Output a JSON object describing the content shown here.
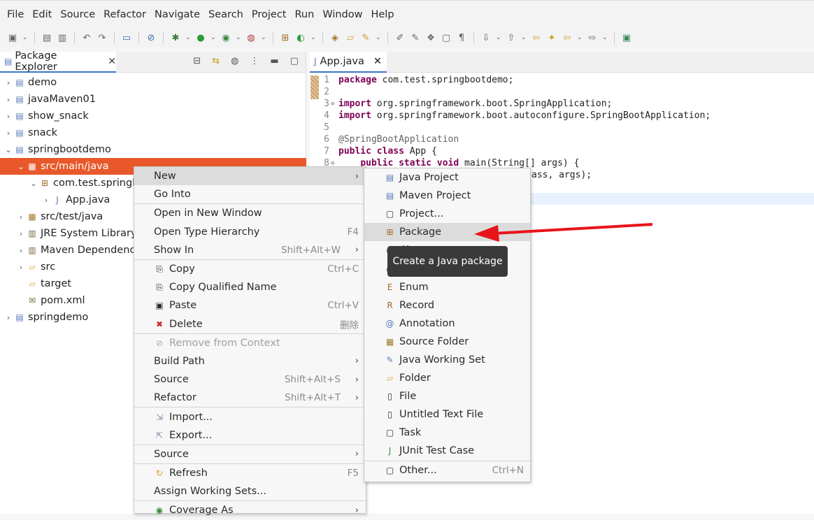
{
  "menubar": [
    "File",
    "Edit",
    "Source",
    "Refactor",
    "Navigate",
    "Search",
    "Project",
    "Run",
    "Window",
    "Help"
  ],
  "package_explorer": {
    "title": "Package Explorer",
    "tree": [
      {
        "label": "demo",
        "icon": "project-icon",
        "twisty": "›"
      },
      {
        "label": "javaMaven01",
        "icon": "project-icon",
        "twisty": "›"
      },
      {
        "label": "show_snack",
        "icon": "project-icon",
        "twisty": "›"
      },
      {
        "label": "snack",
        "icon": "project-icon",
        "twisty": "›"
      },
      {
        "label": "springbootdemo",
        "icon": "maven-project-icon",
        "twisty": "⌄"
      },
      {
        "label": "src/main/java",
        "icon": "source-folder-icon",
        "twisty": "⌄"
      },
      {
        "label": "com.test.springbootdemo",
        "icon": "package-icon",
        "twisty": "⌄"
      },
      {
        "label": "App.java",
        "icon": "java-file-icon",
        "twisty": "›"
      },
      {
        "label": "src/test/java",
        "icon": "source-folder-icon",
        "twisty": "›"
      },
      {
        "label": "JRE System Library [",
        "icon": "library-icon",
        "twisty": "›"
      },
      {
        "label": "Maven Dependencies",
        "icon": "library-icon",
        "twisty": "›"
      },
      {
        "label": "src",
        "icon": "folder-icon",
        "twisty": "›"
      },
      {
        "label": "target",
        "icon": "folder-icon",
        "twisty": ""
      },
      {
        "label": "pom.xml",
        "icon": "xml-file-icon",
        "twisty": ""
      },
      {
        "label": "springdemo",
        "icon": "project-icon",
        "twisty": "›"
      }
    ]
  },
  "editor": {
    "tab": "App.java",
    "lines": [
      {
        "n": "1",
        "t": "package com.test.springbootdemo;"
      },
      {
        "n": "2",
        "t": ""
      },
      {
        "n": "3",
        "t": "import org.springframework.boot.SpringApplication;"
      },
      {
        "n": "4",
        "t": "import org.springframework.boot.autoconfigure.SpringBootApplication;"
      },
      {
        "n": "5",
        "t": ""
      },
      {
        "n": "6",
        "t": "@SpringBootApplication"
      },
      {
        "n": "7",
        "t": "public class App {"
      },
      {
        "n": "8",
        "t": "    public static void main(String[] args) {"
      },
      {
        "n": "9",
        "t": "ass, args);"
      }
    ]
  },
  "context_menu": {
    "items": [
      {
        "label": "New",
        "arrow": "›"
      },
      {
        "label": "Go Into"
      },
      {
        "sep": true
      },
      {
        "label": "Open in New Window"
      },
      {
        "label": "Open Type Hierarchy",
        "shortcut": "F4"
      },
      {
        "label": "Show In",
        "shortcut": "Shift+Alt+W",
        "arrow": "›"
      },
      {
        "sep": true
      },
      {
        "label": "Copy",
        "shortcut": "Ctrl+C",
        "icon": "copy-icon"
      },
      {
        "label": "Copy Qualified Name",
        "icon": "copy-qualified-icon"
      },
      {
        "label": "Paste",
        "shortcut": "Ctrl+V",
        "icon": "paste-icon"
      },
      {
        "label": "Delete",
        "shortcut": "删除",
        "icon": "delete-icon"
      },
      {
        "sep": true
      },
      {
        "label": "Remove from Context",
        "icon": "remove-context-icon",
        "disabled": true
      },
      {
        "label": "Build Path",
        "arrow": "›"
      },
      {
        "label": "Source",
        "shortcut": "Shift+Alt+S",
        "arrow": "›"
      },
      {
        "label": "Refactor",
        "shortcut": "Shift+Alt+T",
        "arrow": "›"
      },
      {
        "sep": true
      },
      {
        "label": "Import...",
        "icon": "import-icon"
      },
      {
        "label": "Export...",
        "icon": "export-icon"
      },
      {
        "sep": true
      },
      {
        "label": "Source",
        "arrow": "›"
      },
      {
        "sep": true
      },
      {
        "label": "Refresh",
        "shortcut": "F5",
        "icon": "refresh-icon"
      },
      {
        "label": "Assign Working Sets..."
      },
      {
        "sep": true
      },
      {
        "label": "Coverage As",
        "arrow": "›",
        "icon": "coverage-icon"
      }
    ]
  },
  "submenu": {
    "items": [
      {
        "label": "Java Project",
        "icon": "java-project-icon"
      },
      {
        "label": "Maven Project",
        "icon": "maven-project-icon"
      },
      {
        "label": "Project...",
        "icon": "project-wizard-icon"
      },
      {
        "label": "Package",
        "icon": "package-icon",
        "highlight": true
      },
      {
        "label": "Class",
        "icon": "class-icon"
      },
      {
        "label": "Interface",
        "icon": "interface-icon"
      },
      {
        "label": "Enum",
        "icon": "enum-icon"
      },
      {
        "label": "Record",
        "icon": "record-icon"
      },
      {
        "label": "Annotation",
        "icon": "annotation-icon"
      },
      {
        "label": "Source Folder",
        "icon": "source-folder-icon"
      },
      {
        "label": "Java Working Set",
        "icon": "working-set-icon"
      },
      {
        "label": "Folder",
        "icon": "folder-icon"
      },
      {
        "label": "File",
        "icon": "file-icon"
      },
      {
        "label": "Untitled Text File",
        "icon": "text-file-icon"
      },
      {
        "label": "Task",
        "icon": "task-icon"
      },
      {
        "label": "JUnit Test Case",
        "icon": "junit-icon"
      },
      {
        "sep": true
      },
      {
        "label": "Other...",
        "shortcut": "Ctrl+N",
        "icon": "other-icon"
      }
    ]
  },
  "tooltip": "Create a Java package",
  "colors": {
    "selection": "#e8582a",
    "arrow": "#e8141b",
    "keyword": "#7f0055"
  }
}
